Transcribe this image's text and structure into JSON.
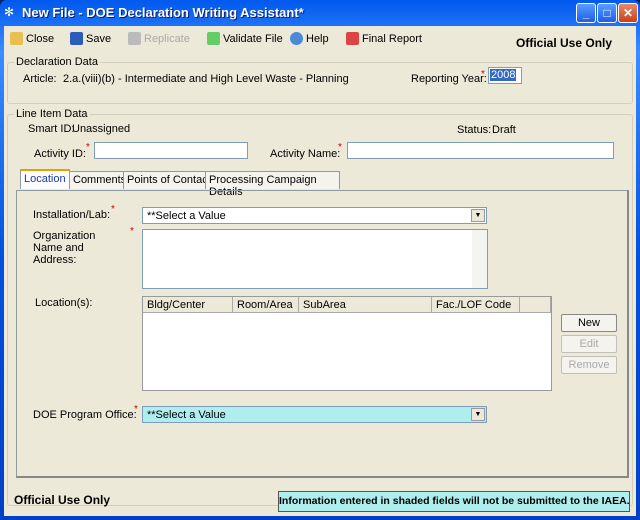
{
  "window": {
    "title": "New File - DOE Declaration Writing Assistant*"
  },
  "toolbar": {
    "items": [
      {
        "label": "Close",
        "icon": "folder-icon"
      },
      {
        "label": "Save",
        "icon": "floppy-disk-icon"
      },
      {
        "label": "Replicate",
        "icon": "replicate-icon",
        "disabled": true
      },
      {
        "label": "Validate File",
        "icon": "validate-check-icon"
      },
      {
        "label": "Help",
        "icon": "help-icon"
      },
      {
        "label": "Final Report",
        "icon": "report-icon"
      }
    ],
    "marking": "Official Use Only"
  },
  "declaration": {
    "legend": "Declaration Data",
    "article_label": "Article:",
    "article_value": "2.a.(viii)(b) - Intermediate and High Level Waste - Planning",
    "year_label": "Reporting Year:",
    "year_value": "2008"
  },
  "line_item": {
    "legend": "Line Item Data",
    "smart_id_label": "Smart ID:",
    "smart_id_value": "Unassigned",
    "status_label": "Status:",
    "status_value": "Draft",
    "activity_id_label": "Activity ID:",
    "activity_id_value": "",
    "activity_name_label": "Activity Name:",
    "activity_name_value": ""
  },
  "tabs": [
    {
      "label": "Location",
      "active": true
    },
    {
      "label": "Comments"
    },
    {
      "label": "Points of Contact"
    },
    {
      "label": "Processing Campaign Details"
    }
  ],
  "location": {
    "installation_label": "Installation/Lab:",
    "installation_value": "**Select a Value",
    "org_label": "Organization Name and Address:",
    "org_value": "",
    "locations_label": "Location(s):",
    "columns": [
      "Bldg/Center",
      "Room/Area",
      "SubArea",
      "Fac./LOF Code"
    ],
    "rows": [],
    "buttons": {
      "new": "New",
      "edit": "Edit",
      "remove": "Remove"
    },
    "program_office_label": "DOE Program Office:",
    "program_office_value": "**Select a Value"
  },
  "required_marker": "*",
  "footer": {
    "marking": "Official Use Only",
    "notice": "Information entered in shaded fields will not be submitted to the IAEA."
  },
  "colors": {
    "shaded_field": "#aeeeee",
    "required": "#cc0000"
  }
}
